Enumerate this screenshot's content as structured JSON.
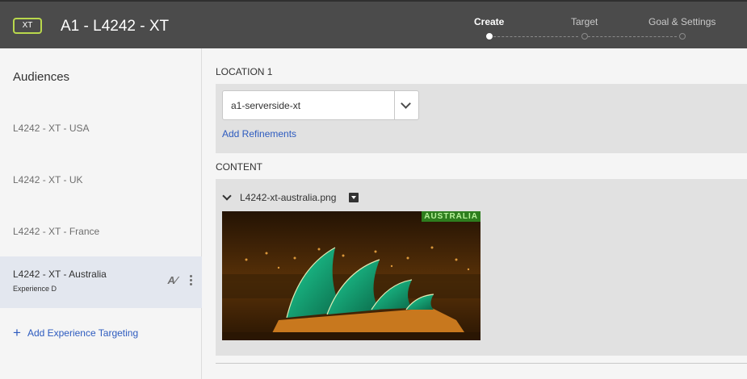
{
  "header": {
    "badge": "XT",
    "title": "A1 - L4242 - XT",
    "steps": [
      {
        "label": "Create",
        "active": true
      },
      {
        "label": "Target",
        "active": false
      },
      {
        "label": "Goal & Settings",
        "active": false
      }
    ]
  },
  "sidebar": {
    "title": "Audiences",
    "items": [
      {
        "label": "L4242 - XT - USA"
      },
      {
        "label": "L4242 - XT - UK"
      },
      {
        "label": "L4242 - XT - France"
      },
      {
        "label": "L4242 - XT - Australia",
        "sub": "Experience D",
        "selected": true
      }
    ],
    "add_label": "Add Experience Targeting"
  },
  "main": {
    "location_label": "LOCATION 1",
    "location_value": "a1-serverside-xt",
    "refinements_link": "Add Refinements",
    "content_label": "CONTENT",
    "file_name": "L4242-xt-australia.png",
    "preview_tag": "AUSTRALIA"
  },
  "icons": {
    "badge": "xt-badge-icon",
    "rename": "rename-icon",
    "more": "more-icon",
    "add": "plus-icon",
    "dropdown": "chevron-down-icon",
    "file_menu": "dropdown-menu-icon"
  },
  "colors": {
    "header_bg": "#4b4b4b",
    "badge_border": "#b9d84c",
    "link": "#2d5bbf",
    "selected_bg": "#e3e7ef"
  }
}
